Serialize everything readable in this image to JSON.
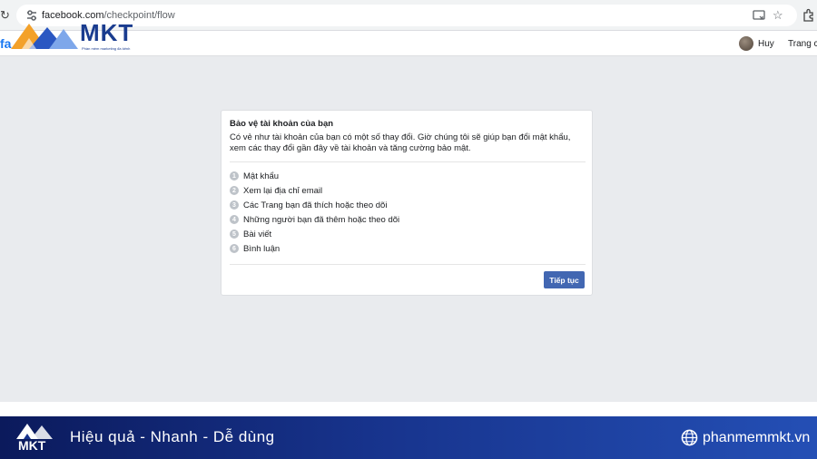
{
  "browser": {
    "url_host": "facebook.com",
    "url_path": "/checkpoint/flow"
  },
  "header": {
    "fb_partial": "fa",
    "overlay_logo_text": "MKT",
    "overlay_logo_sub": "Phần mềm marketing đa kênh",
    "user_name": "Huy",
    "home_link": "Trang c"
  },
  "dialog": {
    "title": "Bảo vệ tài khoản của bạn",
    "description": "Có vẻ như tài khoản của bạn có một số thay đổi. Giờ chúng tôi sẽ giúp bạn đổi mật khẩu, xem các thay đổi gần đây về tài khoản và tăng cường bảo mật.",
    "steps": [
      {
        "num": "1",
        "label": "Mật khẩu"
      },
      {
        "num": "2",
        "label": "Xem lại địa chỉ email"
      },
      {
        "num": "3",
        "label": "Các Trang bạn đã thích hoặc theo dõi"
      },
      {
        "num": "4",
        "label": "Những người bạn đã thêm hoặc theo dõi"
      },
      {
        "num": "5",
        "label": "Bài viết"
      },
      {
        "num": "6",
        "label": "Bình luận"
      }
    ],
    "continue_label": "Tiếp tục"
  },
  "footer": {
    "logo_text": "MKT",
    "slogan": "Hiệu quả - Nhanh  - Dễ dùng",
    "website": "phanmemmkt.vn"
  },
  "colors": {
    "fb_blue": "#4267b2",
    "page_bg": "#e9ebee",
    "footer_dark": "#0b1a5c",
    "footer_light": "#244fb5"
  },
  "icons": [
    "reload-icon",
    "site-settings-icon",
    "cast-icon",
    "bookmark-star-icon",
    "extensions-icon",
    "globe-icon"
  ]
}
